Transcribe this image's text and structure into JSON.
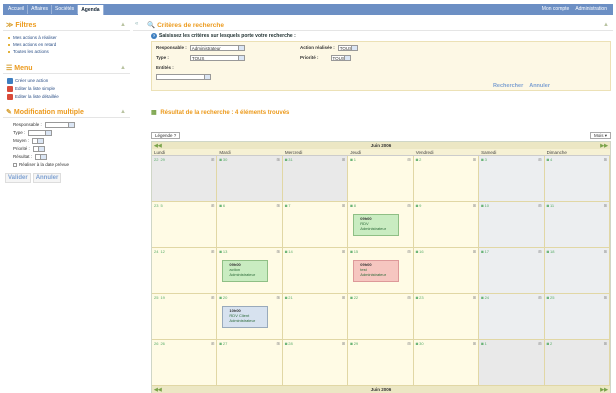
{
  "nav": {
    "tabs": [
      {
        "label": "Accueil"
      },
      {
        "label": "Affaires"
      },
      {
        "label": "Sociétés"
      },
      {
        "label": "Agenda"
      }
    ],
    "right_links": [
      "Mon compte",
      "Administration"
    ]
  },
  "sidebar": {
    "filtres": {
      "title": "Filtres",
      "items": [
        "Mes actions à réaliser",
        "Mes actions en retard",
        "Toutes les actions"
      ]
    },
    "menu": {
      "title": "Menu",
      "items": [
        "Créer une action",
        "Editer la liste simple",
        "Editer la liste détaillée"
      ]
    },
    "modif": {
      "title": "Modification multiple",
      "fields": [
        "Responsable :",
        "Type :",
        "Moyen :",
        "Priorité :",
        "Résultat :"
      ],
      "checkbox_label": "Réaliser à la date prévue",
      "valider": "Valider",
      "annuler": "Annuler"
    }
  },
  "criteria": {
    "title": "Critères de recherche",
    "help": "Saisissez les critères sur lesquels porte votre recherche :",
    "responsable_label": "Responsable :",
    "responsable_value": "Administrateur",
    "action_label": "Action réalisée :",
    "action_value": "TOUS",
    "type_label": "Type :",
    "type_value": "TOUS",
    "priorite_label": "Priorité :",
    "priorite_value": "TOUS",
    "entites_label": "Entités :",
    "rechercher": "Rechercher",
    "annuler": "Annuler"
  },
  "result": {
    "title": "Résultat de la recherche : 4 éléments trouvés"
  },
  "calendar": {
    "legend": "Légende",
    "view": "Mois",
    "month": "Juin 2006",
    "days": [
      "Lundi",
      "Mardi",
      "Mercredi",
      "Jeudi",
      "Vendredi",
      "Samedi",
      "Dimanche"
    ],
    "weeks": [
      [
        "29",
        "30",
        "31",
        "1",
        "2",
        "3",
        "4"
      ],
      [
        "5",
        "6",
        "7",
        "8",
        "9",
        "10",
        "11"
      ],
      [
        "12",
        "13",
        "14",
        "15",
        "16",
        "17",
        "18"
      ],
      [
        "19",
        "20",
        "21",
        "22",
        "23",
        "24",
        "25"
      ],
      [
        "26",
        "27",
        "28",
        "29",
        "30",
        "1",
        "2"
      ]
    ],
    "week_nums": [
      "22",
      "23",
      "24",
      "25",
      "26"
    ],
    "events": [
      {
        "time": "09h00",
        "title": "RDV",
        "who": "Administrateur",
        "color": "green"
      },
      {
        "time": "09h00",
        "title": "action",
        "who": "Administrateur",
        "color": "green"
      },
      {
        "time": "09h00",
        "title": "test",
        "who": "Administrateur",
        "color": "red"
      },
      {
        "time": "10h00",
        "title": "RDV Client",
        "who": "Administrateur",
        "color": "blue"
      }
    ]
  }
}
